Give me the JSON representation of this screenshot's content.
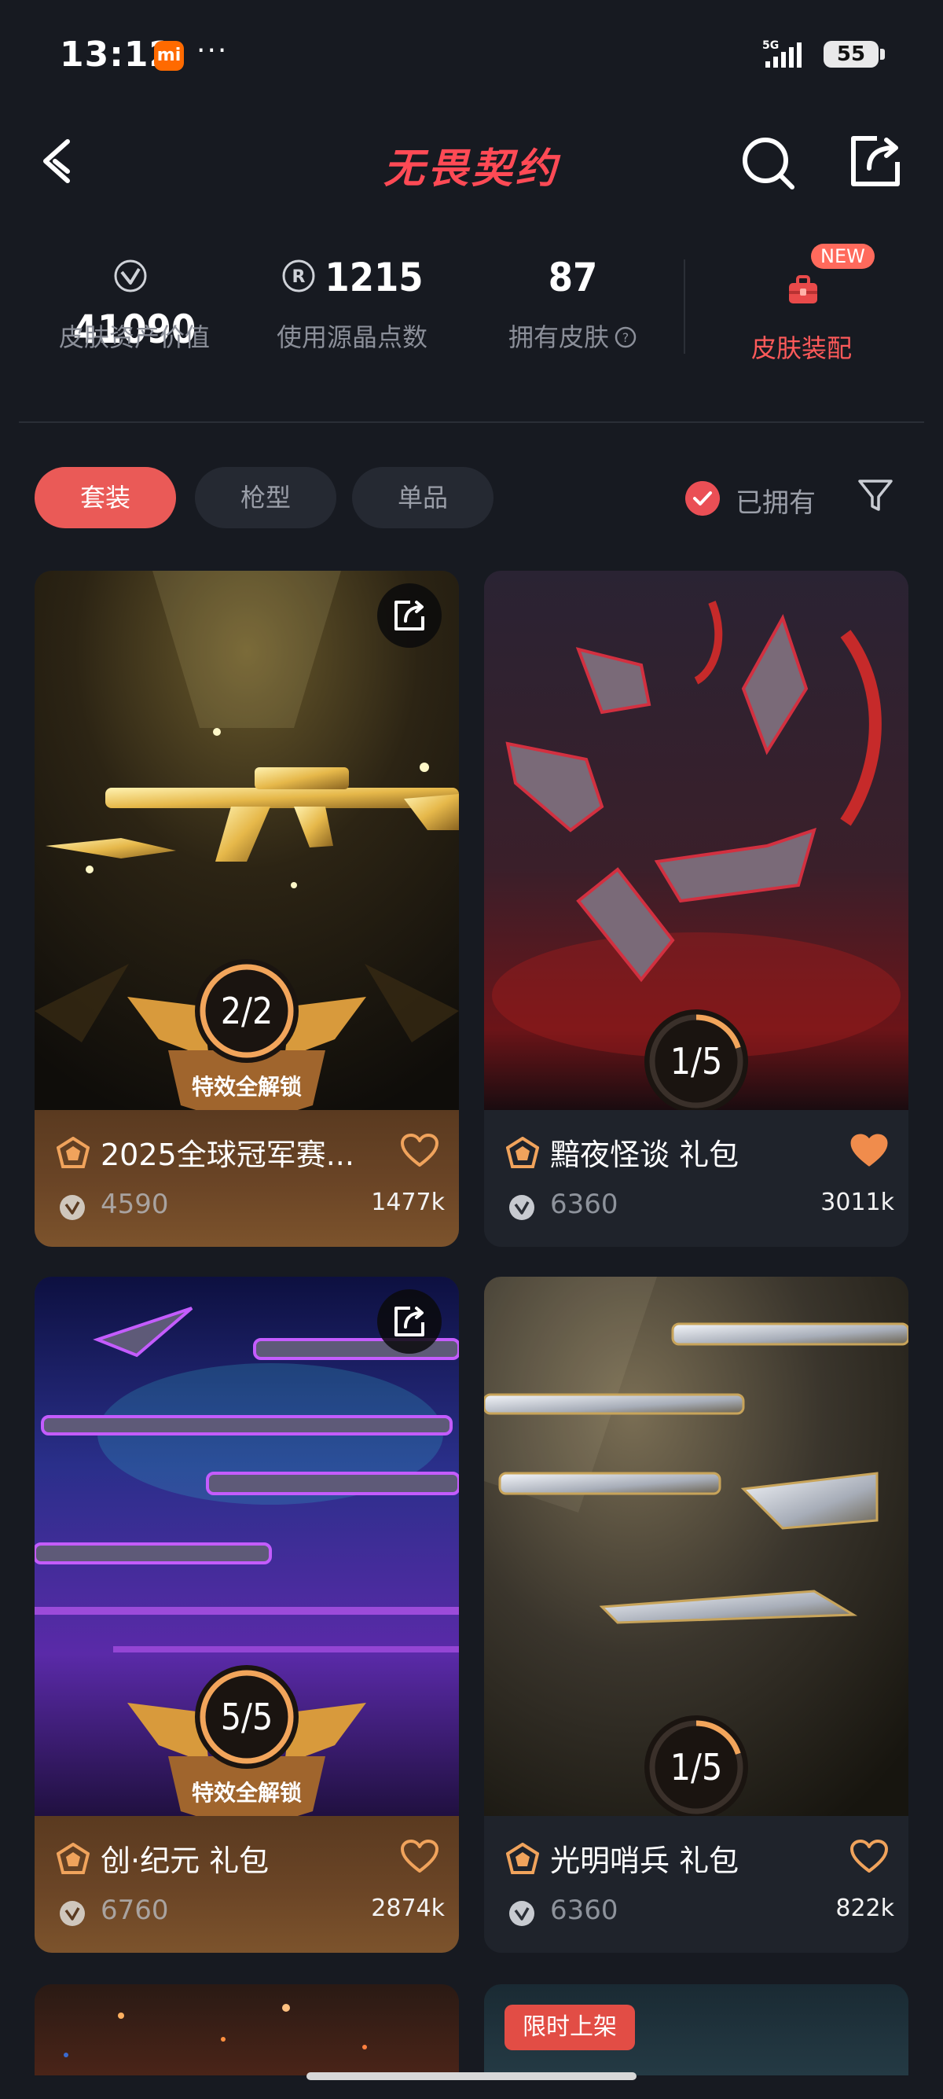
{
  "status_bar": {
    "time": "13:12",
    "app_badge": "mi",
    "more": "···",
    "network": "5G",
    "battery": "55"
  },
  "header": {
    "logo_text": "无畏契约"
  },
  "stats": [
    {
      "value": "41090",
      "label": "皮肤资产价值",
      "icon": "vp-coin-icon"
    },
    {
      "value": "1215",
      "label": "使用源晶点数",
      "icon": "radianite-icon"
    },
    {
      "value": "87",
      "label": "拥有皮肤",
      "icon": "help-circle-icon"
    }
  ],
  "equip": {
    "badge": "NEW",
    "label": "皮肤装配"
  },
  "tabs": [
    {
      "label": "套装",
      "active": true
    },
    {
      "label": "枪型",
      "active": false
    },
    {
      "label": "单品",
      "active": false
    }
  ],
  "owned_filter": {
    "label": "已拥有",
    "checked": true
  },
  "cards": [
    {
      "name": "2025全球冠军赛...",
      "price": "4590",
      "likes": "1477k",
      "progress": "2/2",
      "owned": 2,
      "total": 2,
      "unlock_label": "特效全解锁",
      "liked": false,
      "style": "gold"
    },
    {
      "name": "黯夜怪谈 礼包",
      "price": "6360",
      "likes": "3011k",
      "progress": "1/5",
      "owned": 1,
      "total": 5,
      "liked": true,
      "style": "dark"
    },
    {
      "name": "创·纪元 礼包",
      "price": "6760",
      "likes": "2874k",
      "progress": "5/5",
      "owned": 5,
      "total": 5,
      "unlock_label": "特效全解锁",
      "liked": false,
      "style": "gold"
    },
    {
      "name": "光明哨兵 礼包",
      "price": "6360",
      "likes": "822k",
      "progress": "1/5",
      "owned": 1,
      "total": 5,
      "liked": false,
      "style": "dark"
    }
  ],
  "next_row": {
    "limited_label": "限时上架"
  },
  "colors": {
    "accent": "#ea5a57",
    "gold": "#f2a55b",
    "bg": "#171a21"
  }
}
